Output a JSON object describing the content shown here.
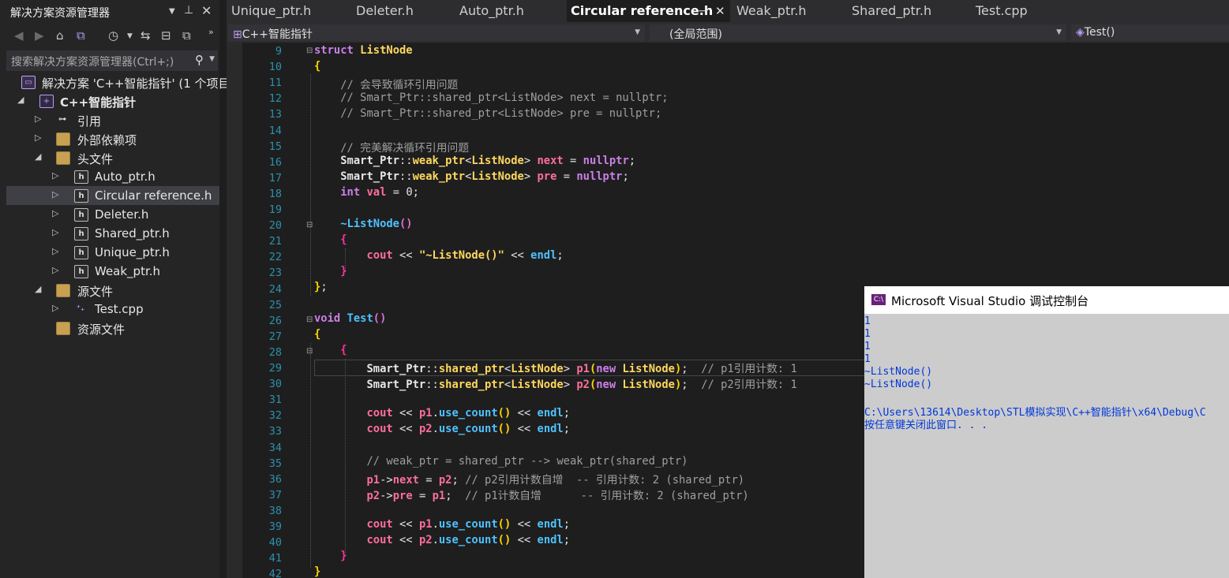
{
  "solution_explorer": {
    "title": "解决方案资源管理器",
    "search_placeholder": "搜索解决方案资源管理器(Ctrl+;)",
    "tree": [
      {
        "label": "解决方案 'C++智能指针' (1 个项目"
      },
      {
        "label": "C++智能指针"
      },
      {
        "label": "引用"
      },
      {
        "label": "外部依赖项"
      },
      {
        "label": "头文件"
      },
      {
        "label": "Auto_ptr.h"
      },
      {
        "label": "Circular reference.h"
      },
      {
        "label": "Deleter.h"
      },
      {
        "label": "Shared_ptr.h"
      },
      {
        "label": "Unique_ptr.h"
      },
      {
        "label": "Weak_ptr.h"
      },
      {
        "label": "源文件"
      },
      {
        "label": "Test.cpp"
      },
      {
        "label": "资源文件"
      }
    ]
  },
  "tabs": [
    {
      "label": "Unique_ptr.h"
    },
    {
      "label": "Deleter.h"
    },
    {
      "label": "Auto_ptr.h"
    },
    {
      "label": "Circular reference.h",
      "active": true
    },
    {
      "label": "Weak_ptr.h"
    },
    {
      "label": "Shared_ptr.h"
    },
    {
      "label": "Test.cpp"
    }
  ],
  "navbar": {
    "project": "C++智能指针",
    "scope": "(全局范围)",
    "member": "Test()"
  },
  "line_numbers": [
    "9",
    "10",
    "11",
    "12",
    "13",
    "14",
    "15",
    "16",
    "17",
    "18",
    "19",
    "20",
    "21",
    "22",
    "23",
    "24",
    "25",
    "26",
    "27",
    "28",
    "29",
    "30",
    "31",
    "32",
    "33",
    "34",
    "35",
    "36",
    "37",
    "38",
    "39",
    "40",
    "41",
    "42"
  ],
  "code": {
    "l9_struct": "struct",
    "l9_name": "ListNode",
    "l11": "// 会导致循环引用问题",
    "l12": "// Smart_Ptr::shared_ptr<ListNode> next = nullptr;",
    "l13": "// Smart_Ptr::shared_ptr<ListNode> pre = nullptr;",
    "l15": "// 完美解决循环引用问题",
    "ns": "Smart_Ptr",
    "weak_ptr": "weak_ptr",
    "shared_ptr": "shared_ptr",
    "listnode": "ListNode",
    "next": "next",
    "pre": "pre",
    "nullptr": "nullptr",
    "int": "int",
    "val": "val",
    "zero": "0",
    "dtor": "~ListNode",
    "cout": "cout",
    "endl": "endl",
    "dtor_str": "\"~ListNode()\"",
    "void": "void",
    "test": "Test",
    "new": "new",
    "p1": "p1",
    "p2": "p2",
    "use_count": "use_count",
    "c29": "// p1引用计数: 1",
    "c30": "// p2引用计数: 1",
    "l35": "// weak_ptr = shared_ptr --> weak_ptr(shared_ptr)",
    "c36": "// p2引用计数自增  -- 引用计数: 2 (shared_ptr)",
    "c37": "// p1计数自增      -- 引用计数: 2 (shared_ptr)"
  },
  "console": {
    "title": "Microsoft Visual Studio 调试控制台",
    "lines": [
      "1",
      "1",
      "1",
      "1",
      "~ListNode()",
      "~ListNode()",
      "",
      "C:\\Users\\13614\\Desktop\\STL模拟实现\\C++智能指针\\x64\\Debug\\C",
      "按任意键关闭此窗口. . ."
    ]
  }
}
